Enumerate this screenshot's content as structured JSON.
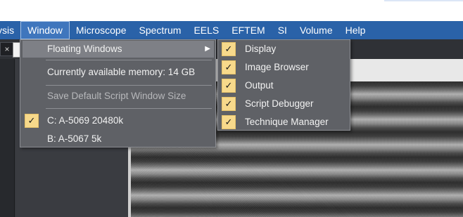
{
  "menubar": {
    "items": [
      {
        "label": "ysis"
      },
      {
        "label": "Window"
      },
      {
        "label": "Microscope"
      },
      {
        "label": "Spectrum"
      },
      {
        "label": "EELS"
      },
      {
        "label": "EFTEM"
      },
      {
        "label": "SI"
      },
      {
        "label": "Volume"
      },
      {
        "label": "Help"
      }
    ]
  },
  "toolbar": {
    "close_glyph": "×"
  },
  "window_menu": {
    "floating_windows": "Floating Windows",
    "memory": "Currently available memory: 14 GB",
    "save_default": "Save Default Script Window Size",
    "drive_c": "C: A-5069  20480k",
    "drive_b": "B: A-5067  5k",
    "submenu_arrow": "▶",
    "check_glyph": "✓"
  },
  "floating_submenu": {
    "items": [
      {
        "label": "Display"
      },
      {
        "label": "Image Browser"
      },
      {
        "label": "Output"
      },
      {
        "label": "Script Debugger"
      },
      {
        "label": "Technique Manager"
      }
    ]
  },
  "colors": {
    "menubar_bg": "#2a62a8",
    "menu_bg": "#5f6166",
    "highlight": "#7e8086",
    "check_bg": "#f7d98b"
  }
}
